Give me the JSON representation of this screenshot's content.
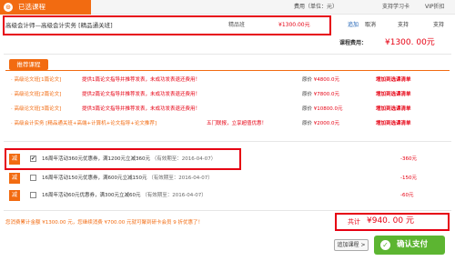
{
  "header": {
    "tab_label": "已选课程",
    "tab_icon": "cart-icon",
    "col_fee": "费用（单位：元）",
    "col_support": "支持学习卡",
    "col_vip": "VIP折扣"
  },
  "course": {
    "name": "高级会计师—高级会计实务 [精品通关班]",
    "type": "精品班",
    "price": "¥1300.00元",
    "add_link": "追加",
    "cancel_link": "取消",
    "support_value": "支持",
    "vip_value": "支持"
  },
  "fee": {
    "label": "课程费用：",
    "value": "¥1300. 00元"
  },
  "recommend": {
    "title": "推荐课程",
    "rows": [
      {
        "name": "· 高级论文班[1篇论文]",
        "desc": "提供1篇论文指导并推荐发表，未成功发表退还费用！",
        "price_label": "原价",
        "price": "¥4800.0元",
        "action": "增加到选课清单"
      },
      {
        "name": "· 高级论文班[2篇论文]",
        "desc": "提供2篇论文指导并推荐发表，未成功发表退还费用！",
        "price_label": "原价",
        "price": "¥7800.0元",
        "action": "增加到选课清单"
      },
      {
        "name": "· 高级论文班[3篇论文]",
        "desc": "提供3篇论文指导并推荐发表，未成功发表退还费用！",
        "price_label": "原价",
        "price": "¥10800.0元",
        "action": "增加到选课清单"
      },
      {
        "name": "· 高级会计实务 [精品通关班+高端+计算机+论文指导+论文推荐]",
        "desc2": "五门联报，立享超值优惠！",
        "price_label": "原价",
        "price": "¥2000.0元",
        "action": "增加到选课清单"
      }
    ]
  },
  "coupons": [
    {
      "badge": "减",
      "checked": "✔",
      "text": "16周年活动360元优惠券，满1200元立减360元",
      "expiry": "（有效期至：2016-04-07）",
      "amount": "-360元"
    },
    {
      "badge": "减",
      "checked": "",
      "text": "16周年活动150元优惠券，满600元立减150元",
      "expiry": "（有效期至：2016-04-07）",
      "amount": "-150元"
    },
    {
      "badge": "减",
      "checked": "",
      "text": "16周年活动60元优惠券，满300元立减60元",
      "expiry": "（有效期至：2016-04-07）",
      "amount": "-60元"
    }
  ],
  "footer": {
    "note": "您消费累计金额 ¥1300.00 元，您继续消费 ¥700.00 元就可聚到研卡会员 9 折优惠了！",
    "total_label": "共计",
    "total_value": "¥940. 00 元",
    "add_course": "追加课程 >",
    "pay_label": "确认支付",
    "pay_icon": "check-icon"
  },
  "colors": {
    "accent": "#f26b11",
    "highlight": "#e60012",
    "pay_button": "#5cb531"
  }
}
